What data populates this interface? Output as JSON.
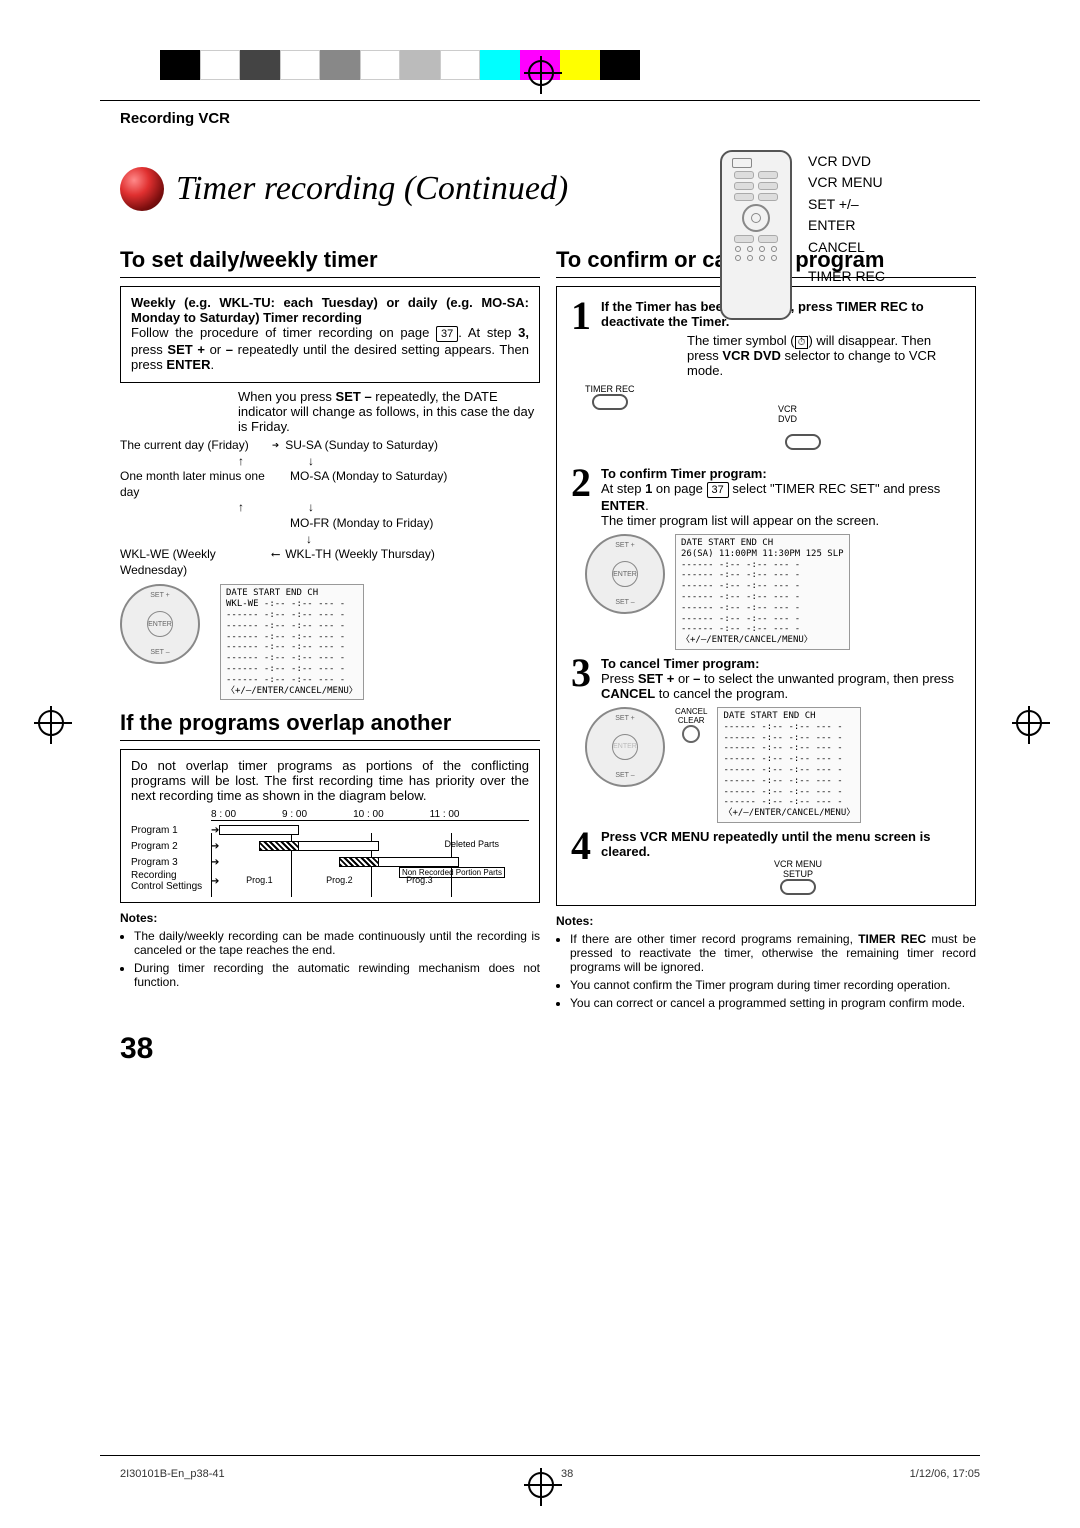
{
  "header": {
    "section": "Recording VCR",
    "title": "Timer recording (Continued)"
  },
  "remote_labels": [
    "VCR DVD",
    "VCR MENU",
    "SET +/–",
    "ENTER",
    "CANCEL",
    "TIMER REC"
  ],
  "left": {
    "h_set": "To set daily/weekly timer",
    "weekly_lead": "Weekly (e.g. WKL-TU: each Tuesday) or daily (e.g. MO-SA: Monday to Saturday) Timer recording",
    "follow_1": "Follow the procedure of timer recording on page ",
    "page_ref_1": "37",
    "follow_2": ". At step ",
    "step_bold": "3,",
    "follow_3": " press ",
    "setplus": "SET +",
    "or": " or ",
    "minus": "–",
    "follow_4": " repeatedly until the desired setting appears. Then press ",
    "enter": "ENTER",
    "period": ".",
    "press_set_minus": "When you press SET – repeatedly, the DATE indicator will change as follows, in this case the day is Friday.",
    "flow": {
      "cur": "The current day (Friday)",
      "susa": "SU-SA (Sunday to Saturday)",
      "month": "One month later minus one day",
      "mosa": "MO-SA (Monday to Saturday)",
      "mofr": "MO-FR (Monday to Friday)",
      "wklwe": "WKL-WE (Weekly Wednesday)",
      "wklth": "WKL-TH (Weekly Thursday)"
    },
    "disp_header": "DATE   START  END   CH",
    "disp_row1": "WKL-WE  -:--  -:--  --- -",
    "disp_dash": "------  -:--  -:--  --- -",
    "disp_footer": "〈+/–/ENTER/CANCEL/MENU〉",
    "h_overlap": "If the programs overlap another",
    "overlap_body": "Do not overlap timer programs as portions of the conflicting programs will be lost. The first recording time has priority over the next recording time as shown in the diagram below.",
    "times": [
      "8 : 00",
      "9 : 00",
      "10 : 00",
      "11 : 00"
    ],
    "rows": [
      "Program 1",
      "Program 2",
      "Program 3",
      "Recording Control Settings"
    ],
    "progs": [
      "Prog.1",
      "Prog.2",
      "Prog.3"
    ],
    "deleted": "Deleted Parts",
    "nonrec": "Non Recorded Portion Parts",
    "notes_h": "Notes:",
    "note1": "The daily/weekly recording can be made continuously until the recording is canceled or the tape reaches the end.",
    "note2": "During timer recording the automatic rewinding mechanism does not function."
  },
  "right": {
    "h_confirm": "To confirm or cancel a program",
    "s1_bold": "If the Timer has been activated, press TIMER REC to deactivate the Timer.",
    "s1_a": "The timer symbol (",
    "s1_b": ") will disappear. Then press ",
    "s1_vcrdvd": "VCR DVD",
    "s1_c": " selector to change to VCR mode.",
    "lbl_timerrec": "TIMER REC",
    "lbl_vcrdvd": "VCR\nDVD",
    "s2_h": "To confirm Timer program:",
    "s2_a": "At step ",
    "s2_b": "1",
    "s2_c": " on page ",
    "s2_pg": "37",
    "s2_d": " select \"TIMER REC SET\" and press ",
    "s2_enter": "ENTER",
    "s2_e": ".",
    "s2_f": "The timer program list will appear on the screen.",
    "disp2_row1": "26(SA) 11:00PM 11:30PM 125 SLP",
    "s3_h": "To cancel Timer program:",
    "s3_a": "Press ",
    "s3_set": "SET +",
    "s3_or": " or ",
    "s3_minus": "–",
    "s3_b": " to select the unwanted program, then press ",
    "s3_cancel": "CANCEL",
    "s3_c": " to cancel the program.",
    "cancel_lbl1": "CANCEL",
    "cancel_lbl2": "CLEAR",
    "s4": "Press VCR MENU repeatedly until the menu screen is cleared.",
    "menu1": "VCR MENU",
    "menu2": "SETUP",
    "notes_h": "Notes:",
    "rn1a": "If there are other timer record programs remaining, ",
    "rn1b": "TIMER REC",
    "rn1c": " must be pressed to reactivate the timer, otherwise the remaining timer record programs will be ignored.",
    "rn2": "You cannot confirm the Timer program during timer recording operation.",
    "rn3": "You can correct or cancel a programmed setting in program confirm mode."
  },
  "page_number": "38",
  "footer": {
    "left": "2I30101B-En_p38-41",
    "mid": "38",
    "right": "1/12/06, 17:05"
  },
  "colorbar": [
    "#000",
    "#fff",
    "#444",
    "#fff",
    "#888",
    "#fff",
    "#bbb",
    "#fff",
    "#00ffff",
    "#ff00ff",
    "#ffff00",
    "#000"
  ]
}
